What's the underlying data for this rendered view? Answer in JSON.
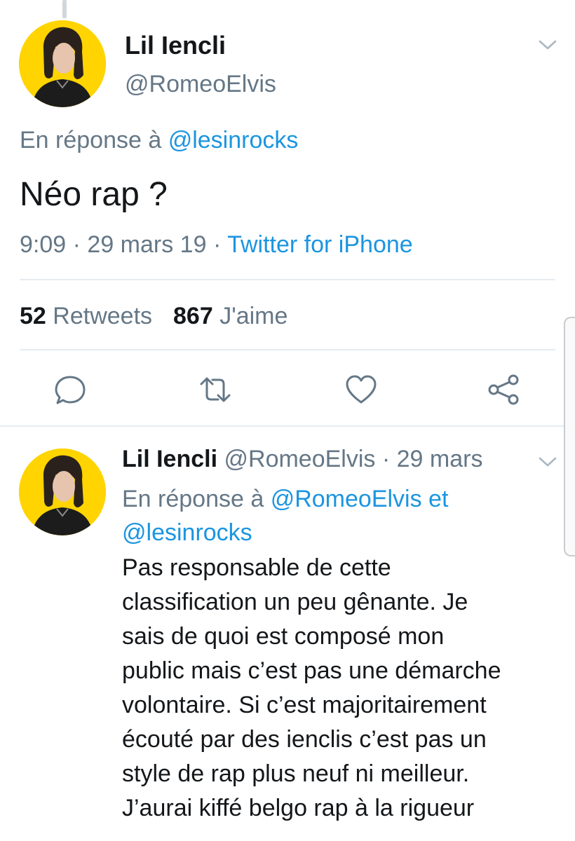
{
  "tweet": {
    "display_name": "Lil Iencli",
    "handle": "@RomeoElvis",
    "reply_prefix": "En réponse à ",
    "reply_mention": "@lesinrocks",
    "text": "Néo rap ?",
    "time": "9:09",
    "date": "29 mars 19",
    "source": "Twitter for iPhone",
    "separator": " · ",
    "retweets_count": "52",
    "retweets_label": "Retweets",
    "likes_count": "867",
    "likes_label": "J'aime"
  },
  "actions": {
    "reply_icon": "reply-icon",
    "retweet_icon": "retweet-icon",
    "like_icon": "heart-icon",
    "share_icon": "share-icon"
  },
  "reply": {
    "display_name": "Lil Iencli",
    "handle": "@RomeoElvis",
    "separator": " · ",
    "date": "29 mars",
    "reply_prefix": "En réponse à ",
    "mention1": "@RomeoElvis",
    "conjunction": " et",
    "mention2": "@lesinrocks",
    "lines": [
      "Pas responsable de cette",
      "classification un peu gênante. Je",
      "sais de quoi est composé mon",
      "public mais c’est pas une démarche",
      "volontaire. Si c’est majoritairement",
      "écouté par des ienclis c’est pas un",
      "style de rap plus neuf ni meilleur.",
      "J’aurai kiffé belgo rap à la rigueur"
    ]
  },
  "colors": {
    "accent": "#1b95e0",
    "secondary_text": "#657786",
    "avatar_background": "#ffd400"
  }
}
